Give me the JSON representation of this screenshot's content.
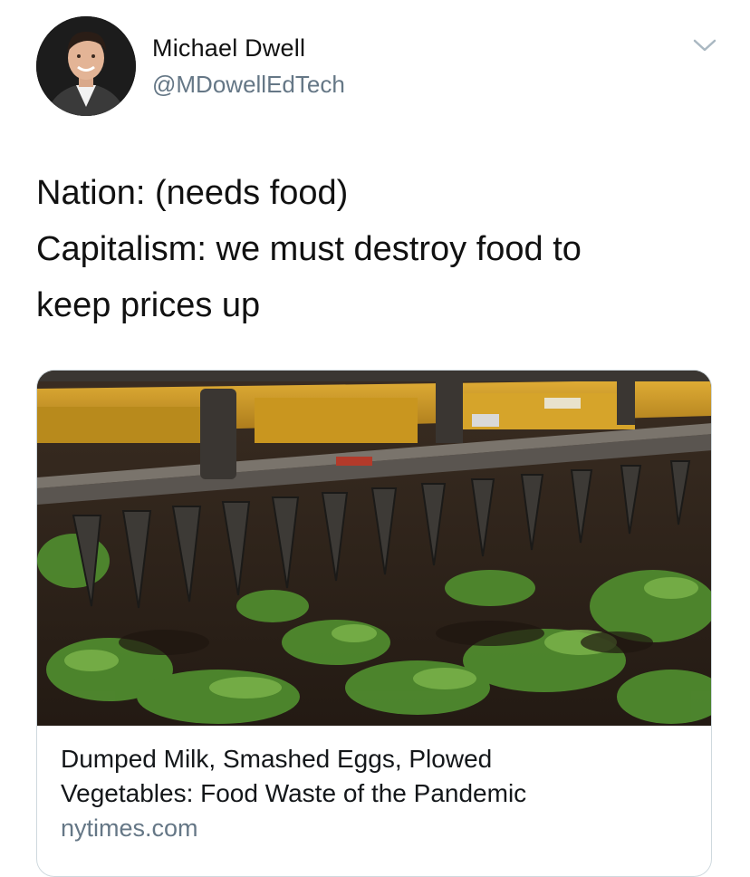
{
  "tweet": {
    "author": {
      "display_name": "Michael Dwell",
      "handle": "@MDowellEdTech"
    },
    "text_lines": [
      "Nation: (needs food)",
      "Capitalism: we must destroy food to",
      "keep prices up"
    ],
    "menu_icon": "chevron-down-icon"
  },
  "card": {
    "image_subject": "disc harrow plowing vegetable field",
    "title_lines": [
      "Dumped Milk, Smashed Eggs, Plowed",
      "Vegetables: Food Waste of the Pandemic"
    ],
    "domain": "nytimes.com"
  },
  "colors": {
    "secondary_text": "#657786",
    "card_border": "#cfd9de",
    "machinery_yellow": "#c9961f",
    "soil": "#2e241c",
    "foliage": "#4f8a2e"
  }
}
